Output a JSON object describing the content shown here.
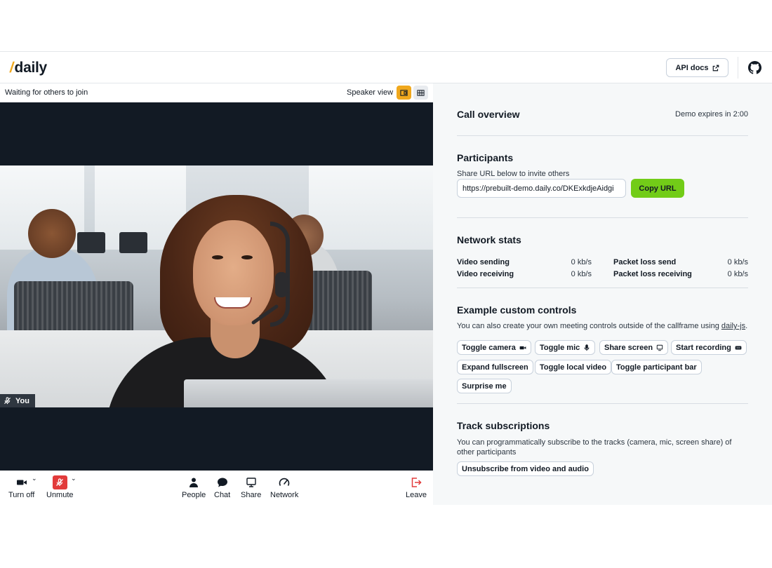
{
  "header": {
    "logo_text": "daily",
    "logo_slash": "/",
    "api_docs_label": "API docs"
  },
  "call": {
    "waiting_text": "Waiting for others to join",
    "speaker_view_label": "Speaker view",
    "participant_name": "You"
  },
  "tray": {
    "camera_label": "Turn off",
    "mic_label": "Unmute",
    "people_label": "People",
    "chat_label": "Chat",
    "share_label": "Share",
    "network_label": "Network",
    "leave_label": "Leave",
    "caret": "⌄"
  },
  "sidebar": {
    "overview_title": "Call overview",
    "demo_expires": "Demo expires in 2:00",
    "participants": {
      "title": "Participants",
      "subtitle": "Share URL below to invite others",
      "url_value": "https://prebuilt-demo.daily.co/DKExkdjeAidgi",
      "copy_label": "Copy URL"
    },
    "network": {
      "title": "Network stats",
      "video_sending_label": "Video sending",
      "video_sending_value": "0 kb/s",
      "video_receiving_label": "Video receiving",
      "video_receiving_value": "0 kb/s",
      "packet_loss_send_label": "Packet loss send",
      "packet_loss_send_value": "0 kb/s",
      "packet_loss_receiving_label": "Packet loss receiving",
      "packet_loss_receiving_value": "0 kb/s"
    },
    "controls": {
      "title": "Example custom controls",
      "desc_prefix": "You can also create your own meeting controls outside of the callframe using ",
      "desc_link": "daily-js",
      "desc_suffix": ".",
      "toggle_camera": "Toggle camera",
      "toggle_mic": "Toggle mic",
      "share_screen": "Share screen",
      "start_recording": "Start recording",
      "expand_fullscreen": "Expand fullscreen",
      "toggle_local_video": "Toggle local video",
      "toggle_participant_bar": "Toggle participant bar",
      "surprise_me": "Surprise me"
    },
    "tracks": {
      "title": "Track subscriptions",
      "desc": "You can programmatically subscribe to the tracks (camera, mic, screen share) of other participants",
      "unsubscribe_label": "Unsubscribe from video and audio"
    }
  },
  "colors": {
    "accent_orange": "#f0a81d",
    "accent_green": "#72cc18",
    "danger_red": "#e23b3b",
    "dark": "#121a24"
  }
}
